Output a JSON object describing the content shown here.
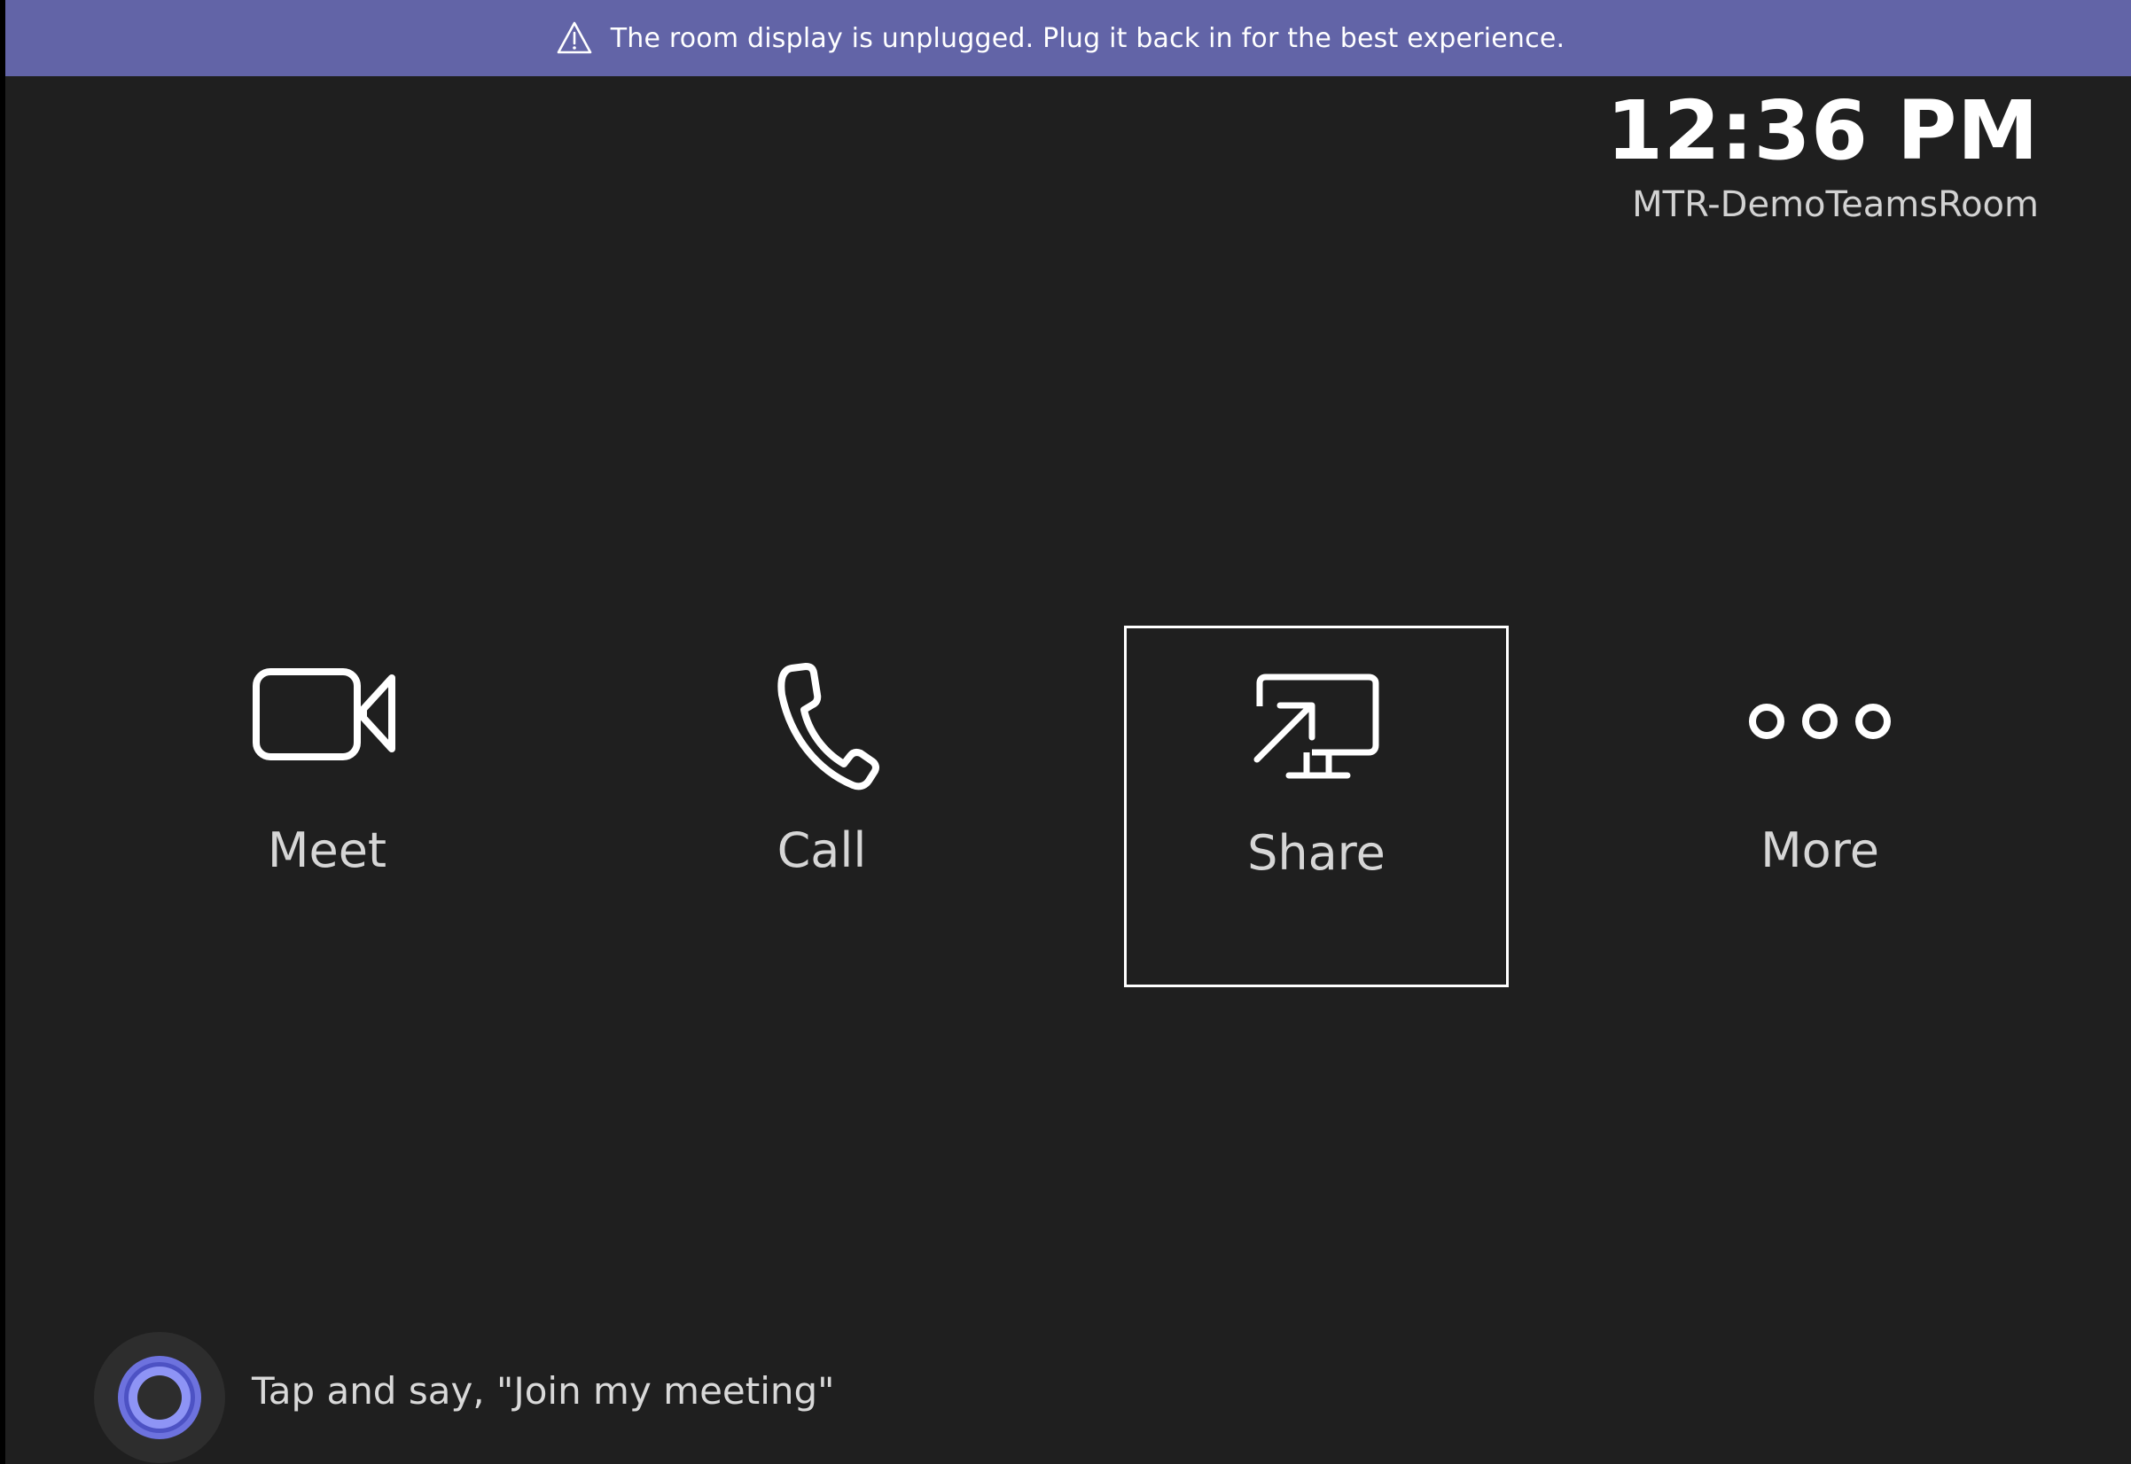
{
  "banner": {
    "icon": "warning-icon",
    "message": "The room display is unplugged. Plug it back in for the best experience.",
    "color": "#6264a7"
  },
  "header": {
    "time": "12:36 PM",
    "room_name": "MTR-DemoTeamsRoom"
  },
  "actions": [
    {
      "label": "Meet",
      "icon": "video-camera-icon",
      "selected": false
    },
    {
      "label": "Call",
      "icon": "phone-icon",
      "selected": false
    },
    {
      "label": "Share",
      "icon": "share-screen-icon",
      "selected": true
    },
    {
      "label": "More",
      "icon": "more-icon",
      "selected": false
    }
  ],
  "voice": {
    "icon": "cortana-icon",
    "prompt": "Tap and say, \"Join my meeting\"",
    "accent_color": "#7b83eb"
  },
  "theme": {
    "background": "#1f1f1f",
    "text": "#ffffff",
    "label_text": "#d6d6d6"
  }
}
